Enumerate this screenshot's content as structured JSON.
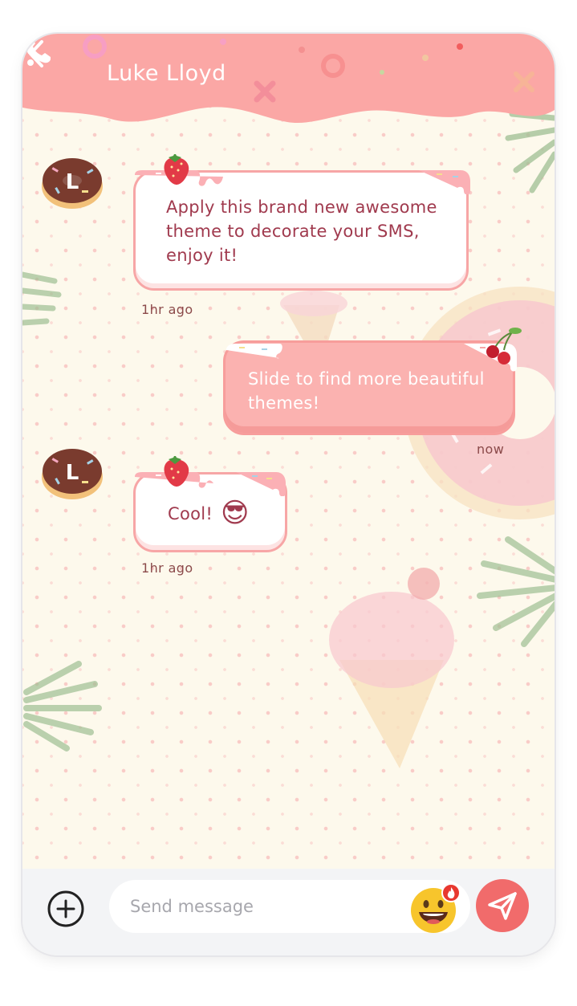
{
  "header": {
    "title": "Luke Lloyd",
    "back_icon": "chevron-left-icon",
    "call_icon": "phone-icon",
    "more_icon": "more-vertical-icon"
  },
  "colors": {
    "header_pink": "#fba7a5",
    "background": "#fdf9ec",
    "incoming_text": "#a03a4e",
    "outgoing_bubble": "#fbb2b0",
    "send_button": "#f16b6b"
  },
  "messages": [
    {
      "direction": "incoming",
      "avatar_letter": "L",
      "text": "Apply this brand new awesome theme to decorate your SMS, enjoy it!",
      "time": "1hr ago"
    },
    {
      "direction": "outgoing",
      "text": "Slide to find more beautiful themes!",
      "time": "now"
    },
    {
      "direction": "incoming",
      "avatar_letter": "L",
      "text": "Cool!",
      "emoji": "😎",
      "time": "1hr ago"
    }
  ],
  "composer": {
    "placeholder": "Send message",
    "add_icon": "plus-circle-icon",
    "emoji_icon": "smiley-face-icon",
    "send_icon": "paper-plane-icon"
  }
}
